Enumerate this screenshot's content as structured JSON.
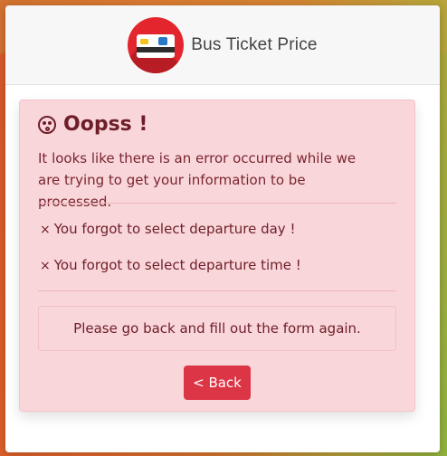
{
  "header": {
    "title": "Bus Ticket Price",
    "logo_icon": "bus-ticket-icon"
  },
  "alert": {
    "heading": "Oopss !",
    "heading_icon": "dizzy-face-icon",
    "intro": "It looks like there is an error occurred while we are trying to get your information to be processed.",
    "errors": [
      "You forgot to select departure day !",
      "You forgot to select departure time !"
    ],
    "error_icon": "×",
    "notice": "Please go back and fill out the form again.",
    "back_label": "< Back"
  },
  "colors": {
    "alert_bg": "#f9d6da",
    "alert_text": "#7a2530",
    "button_bg": "#dc3545",
    "logo_red": "#e3262e"
  }
}
